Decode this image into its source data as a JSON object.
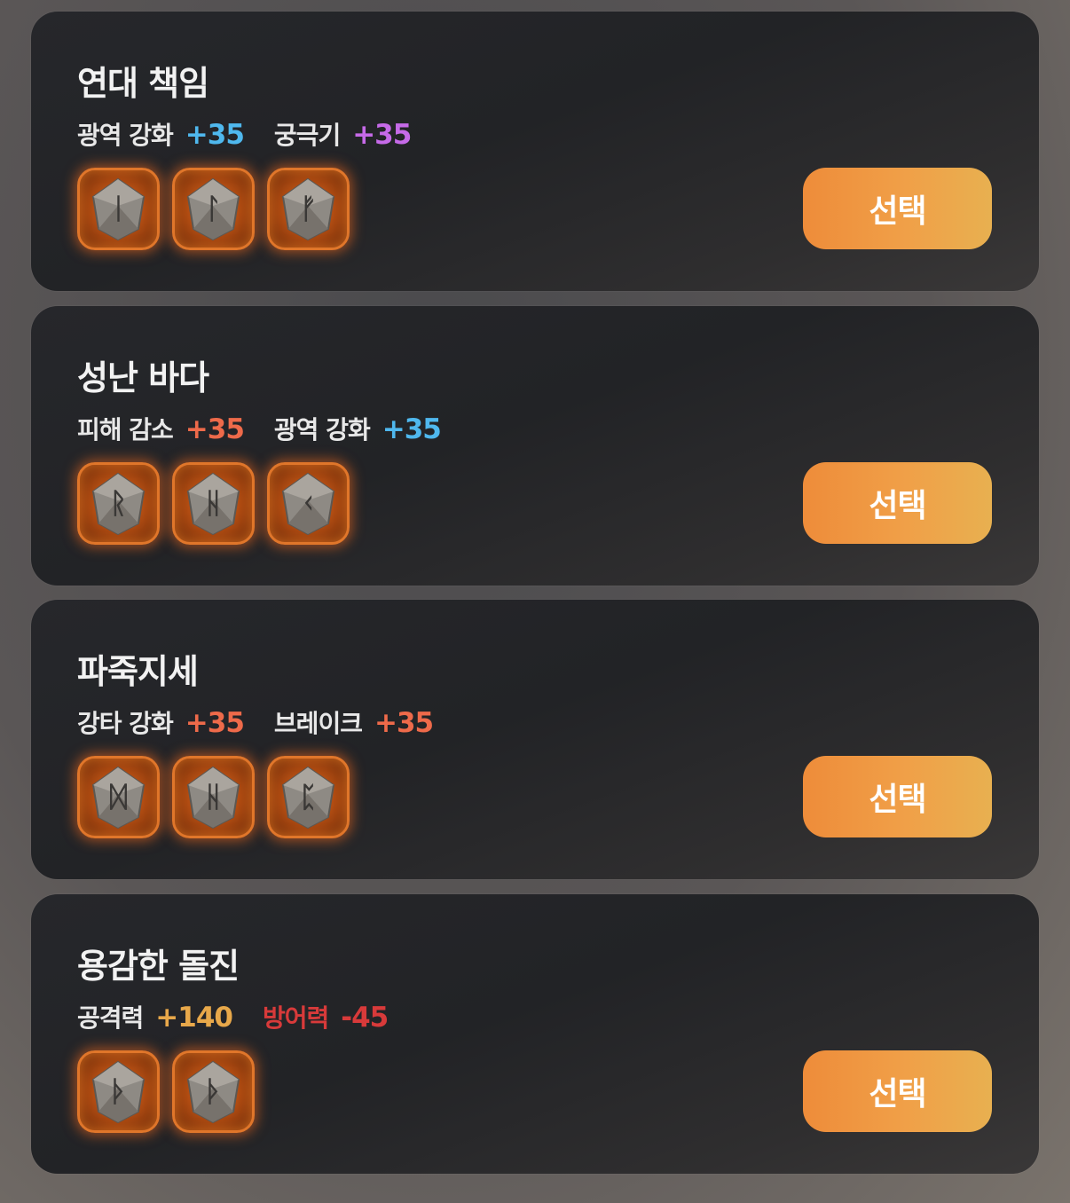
{
  "cards": [
    {
      "title": "연대 책임",
      "stats": [
        {
          "name": "광역 강화",
          "value": "+35",
          "name_color": "#e8e8e8",
          "value_color": "#4fb8ee"
        },
        {
          "name": "궁극기",
          "value": "+35",
          "name_color": "#e8e8e8",
          "value_color": "#c66ae8"
        }
      ],
      "runes": [
        "ᛁ",
        "ᛚ",
        "ᚠ"
      ],
      "button": "선택"
    },
    {
      "title": "성난 바다",
      "stats": [
        {
          "name": "피해 감소",
          "value": "+35",
          "name_color": "#e8e8e8",
          "value_color": "#ee6a4a"
        },
        {
          "name": "광역 강화",
          "value": "+35",
          "name_color": "#e8e8e8",
          "value_color": "#4fb8ee"
        }
      ],
      "runes": [
        "ᚱ",
        "ᚺ",
        "ᚲ"
      ],
      "button": "선택"
    },
    {
      "title": "파죽지세",
      "stats": [
        {
          "name": "강타 강화",
          "value": "+35",
          "name_color": "#e8e8e8",
          "value_color": "#ee6a4a"
        },
        {
          "name": "브레이크",
          "value": "+35",
          "name_color": "#e8e8e8",
          "value_color": "#ee6a4a"
        }
      ],
      "runes": [
        "ᛞ",
        "ᚺ",
        "ᛈ"
      ],
      "button": "선택"
    },
    {
      "title": "용감한 돌진",
      "stats": [
        {
          "name": "공격력",
          "value": "+140",
          "name_color": "#e8e8e8",
          "value_color": "#e8a84a"
        },
        {
          "name": "방어력",
          "value": "-45",
          "name_color": "#d83a3a",
          "value_color": "#d83a3a"
        }
      ],
      "runes": [
        "ᚦ",
        "ᚦ"
      ],
      "button": "선택"
    }
  ],
  "colors": {
    "button_start": "#ee8c3a",
    "button_end": "#e8b050",
    "rune_border": "#e0762a"
  }
}
